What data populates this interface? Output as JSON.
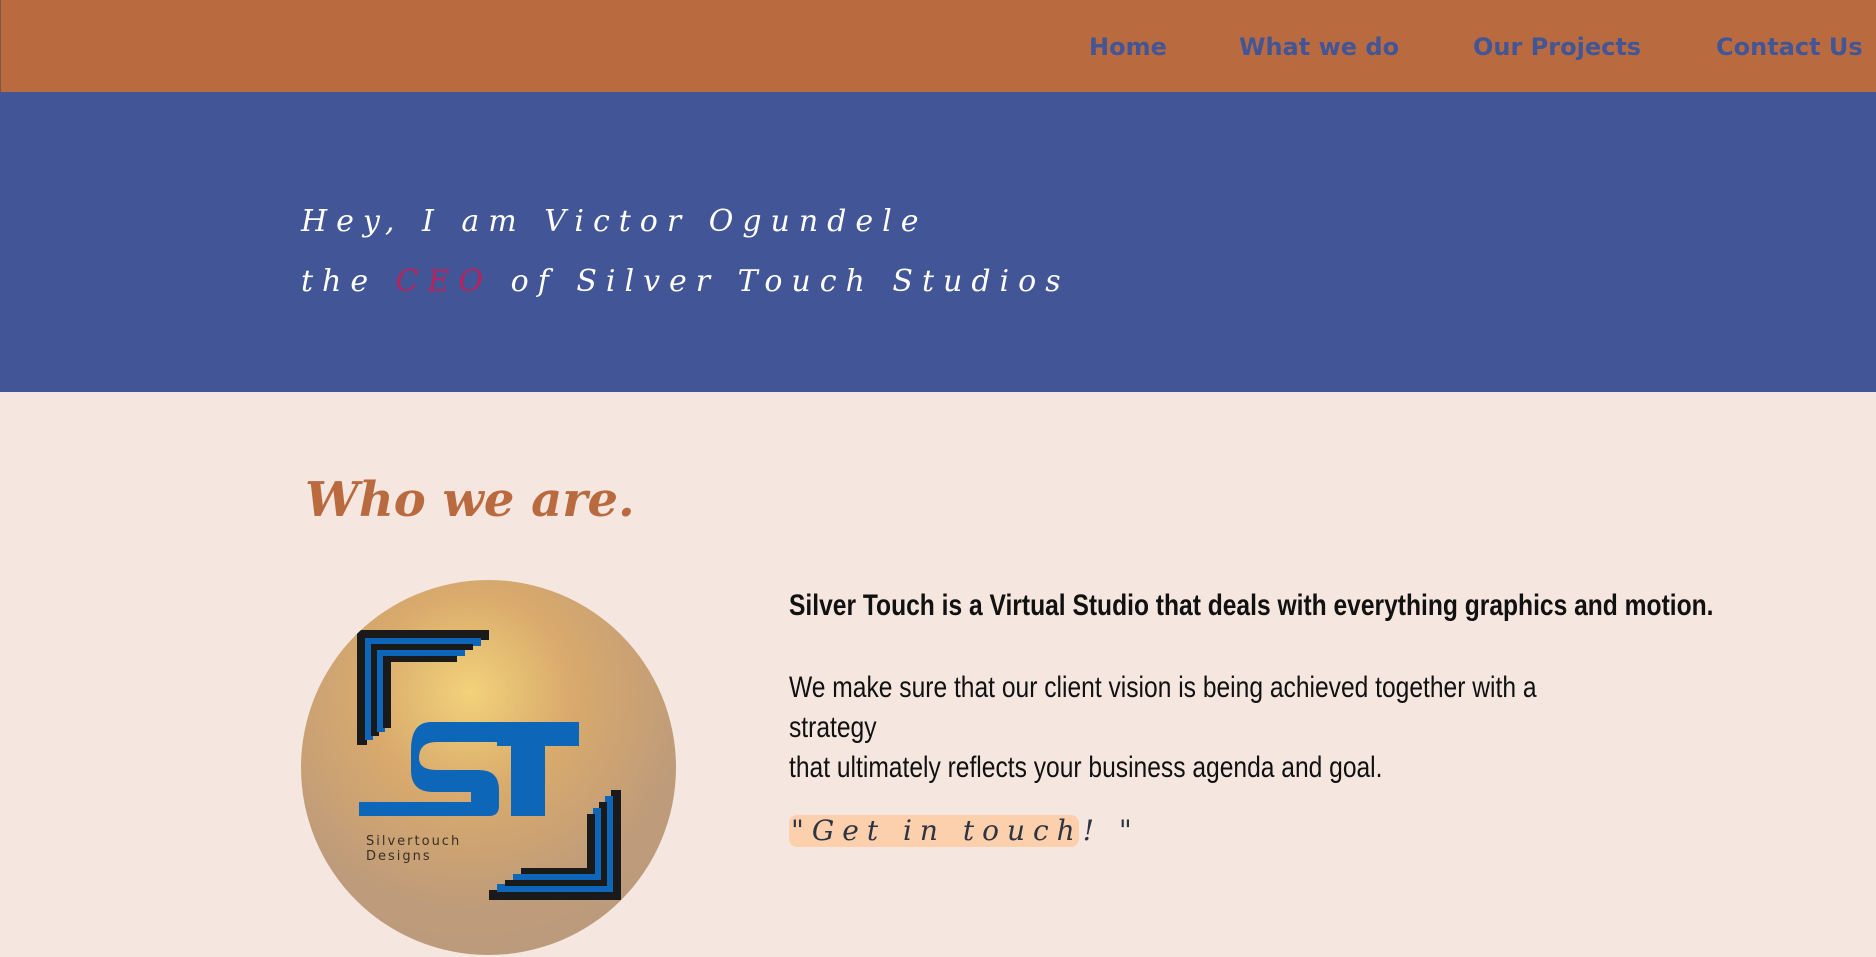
{
  "nav": {
    "items": [
      {
        "label": "Home"
      },
      {
        "label": "What we do"
      },
      {
        "label": "Our Projects"
      },
      {
        "label": "Contact Us"
      }
    ]
  },
  "hero": {
    "line1": "Hey, I am Victor Ogundele",
    "line2_prefix": "the ",
    "line2_accent": "CEO",
    "line2_suffix": " of Silver Touch Studios"
  },
  "about": {
    "title": "Who we are.",
    "logo_caption_line1": "Silvertouch",
    "logo_caption_line2": "Designs",
    "lead": "Silver Touch is a Virtual Studio that deals with everything graphics and motion.",
    "body_line1": "We make sure that our client vision is being achieved together with a strategy",
    "body_line2": "that ultimately reflects your business agenda and goal.",
    "cta_label": "\"Get in touch! \""
  },
  "colors": {
    "nav_bg": "#b96b3f",
    "nav_link": "#425597",
    "hero_bg": "#425597",
    "accent": "#b7235b",
    "page_bg": "#f5e6df",
    "cta_bg": "#fcd0ad",
    "logo_blue": "#0e66b8"
  }
}
